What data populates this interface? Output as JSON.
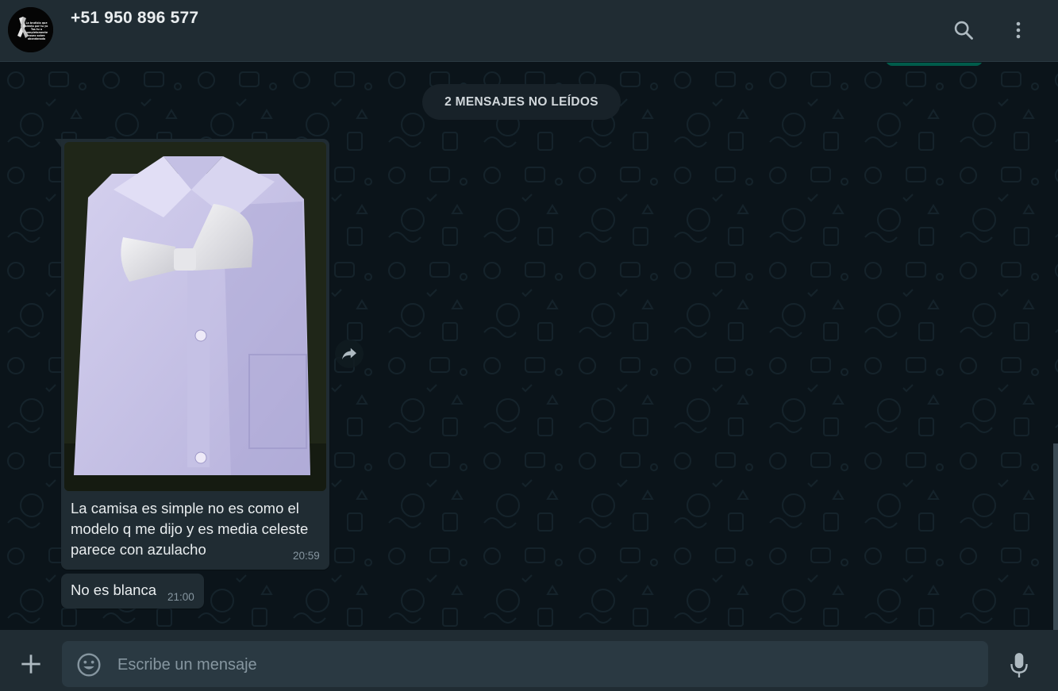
{
  "header": {
    "contact_name": "+51 950 896 577",
    "avatar_caption": "La bruticia que sienta por tu yo Tas tu a completamente roseo sobre abandonada"
  },
  "chat": {
    "unread_banner": "2 MENSAJES NO LEÍDOS",
    "messages": [
      {
        "type": "image",
        "caption": "La camisa es simple no es como el modelo q me dijo y es media celeste parece con azulacho",
        "time": "20:59"
      },
      {
        "type": "text",
        "text": "No es blanca",
        "time": "21:00"
      }
    ]
  },
  "composer": {
    "placeholder": "Escribe un mensaje"
  },
  "icons": {
    "search": "search-icon",
    "menu": "kebab-menu-icon",
    "forward": "forward-icon",
    "attach": "plus-icon",
    "emoji": "emoji-icon",
    "mic": "microphone-icon"
  },
  "colors": {
    "header_bg": "#202c33",
    "chat_bg": "#0b141a",
    "bubble_in": "#202c33",
    "bubble_out": "#005c4b",
    "text_primary": "#e9edef",
    "text_secondary": "#8696a0"
  }
}
